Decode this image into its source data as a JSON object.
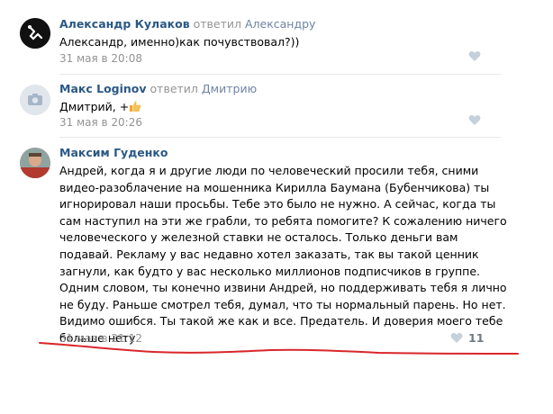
{
  "comments": [
    {
      "author": "Александр Кулаков",
      "replied": "ответил",
      "reply_to": "Александру",
      "text": "Александр, именно)как почувствовал?))",
      "date": "31 мая в 20:08",
      "like_icon": "heart-icon"
    },
    {
      "author": "Макс Loginov",
      "replied": "ответил",
      "reply_to": "Дмитрию",
      "text": "Дмитрий, +",
      "date": "31 мая в 20:26",
      "like_icon": "heart-icon"
    },
    {
      "author": "Максим Гуденко",
      "lines": [
        "Андрей, когда я и другие люди по человеческий просили тебя, сними",
        "видео-разоблачение на мошенника Кирилла Баумана (Бубенчикова) ты",
        "игнорировал наши просьбы. Тебе это было не нужно. А сейчас, когда ты",
        "сам наступил на эти же грабли, то ребята помогите? К сожалению ничего",
        "человеческого у железной ставки не осталось. Только деньги вам",
        "подавай. Рекламу у вас недавно хотел заказать, так вы такой ценник",
        "загнули, как будто у вас несколько миллионов подписчиков в группе.",
        "Одним словом, ты конечно извини Андрей, но поддерживать тебя я лично",
        "не буду. Раньше смотрел тебя, думал, что ты нормальный парень. Но нет.",
        "Видимо ошибся. Ты такой же как и все. Предатель. И доверия моего тебе",
        "больше нету."
      ],
      "date": "31 мая в 21:12",
      "likes": "11",
      "like_icon": "heart-icon"
    }
  ],
  "colors": {
    "link": "#2a5885",
    "meta": "#939393",
    "underline": "#d9262b"
  }
}
